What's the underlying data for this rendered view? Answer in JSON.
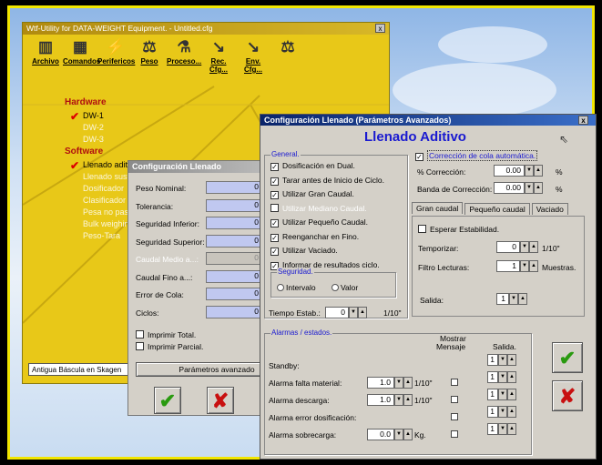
{
  "main_window": {
    "title": "Wtf-Utility for DATA-WEIGHT Equipment. - Untitled.cfg",
    "close": "x",
    "toolbar": [
      {
        "label": "Archivo",
        "icon": "archive-icon",
        "glyph": "▥"
      },
      {
        "label": "Comandos",
        "icon": "commands-icon",
        "glyph": "▦"
      },
      {
        "label": "Perifericos",
        "icon": "plug-icon",
        "glyph": "⚡"
      },
      {
        "label": "Peso",
        "icon": "scale-icon",
        "glyph": "⚖"
      },
      {
        "label": "Proceso...",
        "icon": "flask-icon",
        "glyph": "⚗"
      },
      {
        "label": "Rec. Cfg...",
        "icon": "receive-config-icon",
        "glyph": "↘"
      },
      {
        "label": "Env. Cfg...",
        "icon": "send-config-icon",
        "glyph": "↘"
      },
      {
        "label": "",
        "icon": "balance-icon",
        "glyph": "⚖"
      }
    ],
    "tree": {
      "hardware_label": "Hardware",
      "hardware_items": [
        {
          "label": "DW-1",
          "checked": true
        },
        {
          "label": "DW-2",
          "checked": false
        },
        {
          "label": "DW-3",
          "checked": false
        }
      ],
      "software_label": "Software",
      "software_items": [
        {
          "label": "Llenado aditivo",
          "checked": true
        },
        {
          "label": "Llenado sustract.",
          "checked": false
        },
        {
          "label": "Dosificador",
          "checked": false
        },
        {
          "label": "Clasificador",
          "checked": false
        },
        {
          "label": "Pesa no pasa",
          "checked": false
        },
        {
          "label": "Bulk weighing",
          "checked": false
        },
        {
          "label": "Peso-Tara",
          "checked": false
        }
      ]
    },
    "status_bar": "Antigua Báscula en Skagen"
  },
  "config_window": {
    "title": "Configuración Llenado",
    "fields": [
      {
        "label": "Peso Nominal:",
        "value": "0",
        "disabled": false
      },
      {
        "label": "Tolerancia:",
        "value": "0",
        "disabled": false
      },
      {
        "label": "Seguridad Inferior:",
        "value": "0",
        "disabled": false
      },
      {
        "label": "Seguridad Superior:",
        "value": "0",
        "disabled": false
      },
      {
        "label": "Caudal Medio a...:",
        "value": "0",
        "disabled": true
      },
      {
        "label": "Caudal Fino a...:",
        "value": "0",
        "disabled": false
      },
      {
        "label": "Error de Cola:",
        "value": "0",
        "disabled": false
      },
      {
        "label": "Ciclos:",
        "value": "0",
        "disabled": false
      }
    ],
    "print_total": "Imprimir Total.",
    "print_partial": "Imprimir Parcial.",
    "advanced_button": "Parámetros avanzado"
  },
  "advanced_window": {
    "title": "Configuración Llenado (Parámetros Avanzados)",
    "close": "x",
    "heading": "Llenado Aditivo",
    "general": {
      "label": "General.",
      "options": [
        {
          "label": "Dosificación en Dual.",
          "checked": true,
          "disabled": false
        },
        {
          "label": "Tarar antes de Inicio de Ciclo.",
          "checked": true,
          "disabled": false
        },
        {
          "label": "Utilizar Gran Caudal.",
          "checked": true,
          "disabled": false
        },
        {
          "label": "Utilizar Mediano Caudal.",
          "checked": false,
          "disabled": true
        },
        {
          "label": "Utilizar Pequeño Caudal.",
          "checked": true,
          "disabled": false
        },
        {
          "label": "Reenganchar en Fino.",
          "checked": true,
          "disabled": false
        },
        {
          "label": "Utilizar Vaciado.",
          "checked": true,
          "disabled": false
        },
        {
          "label": "Informar de resultados ciclo.",
          "checked": true,
          "disabled": false
        }
      ],
      "seguridad_label": "Seguridad.",
      "radio_intervalo": "Intervalo",
      "radio_valor": "Valor",
      "tiempo_label": "Tiempo Estab.:",
      "tiempo_value": "0",
      "tiempo_unit": "1/10\""
    },
    "correccion": {
      "auto_label": "Corrección de cola automática.",
      "auto_checked": true,
      "pct_label": "% Corrección:",
      "pct_value": "0.00",
      "pct_unit": "%",
      "banda_label": "Banda de Corrección:",
      "banda_value": "0.00",
      "banda_unit": "%"
    },
    "tabs": [
      "Gran caudal",
      "Pequeño caudal",
      "Vaciado"
    ],
    "gran_caudal": {
      "esperar_label": "Esperar Estabilidad.",
      "temporizar_label": "Temporizar:",
      "temporizar_value": "0",
      "temporizar_unit": "1/10\"",
      "filtro_label": "Filtro Lecturas:",
      "filtro_value": "1",
      "filtro_unit": "Muestras.",
      "salida_label": "Salida:",
      "salida_value": "1"
    },
    "alarmas": {
      "label": "Alarmas / estados.",
      "col_mostrar": "Mostrar",
      "col_mensaje": "Mensaje",
      "col_salida": "Salida.",
      "rows": [
        {
          "label": "Standby:",
          "value": "",
          "unit": "",
          "salida": "1"
        },
        {
          "label": "Alarma falta material:",
          "value": "1.0",
          "unit": "1/10\"",
          "salida": "1"
        },
        {
          "label": "Alarma descarga:",
          "value": "1.0",
          "unit": "1/10\"",
          "salida": "1"
        },
        {
          "label": "Alarma error dosificación:",
          "value": "",
          "unit": "",
          "salida": "1"
        },
        {
          "label": "Alarma sobrecarga:",
          "value": "0.0",
          "unit": "Kg.",
          "salida": "1"
        }
      ]
    }
  },
  "colors": {
    "accent_blue": "#1a1ad0",
    "ok_green": "#2a9a10",
    "cancel_red": "#c81010",
    "frame_yellow": "#f2e600"
  }
}
